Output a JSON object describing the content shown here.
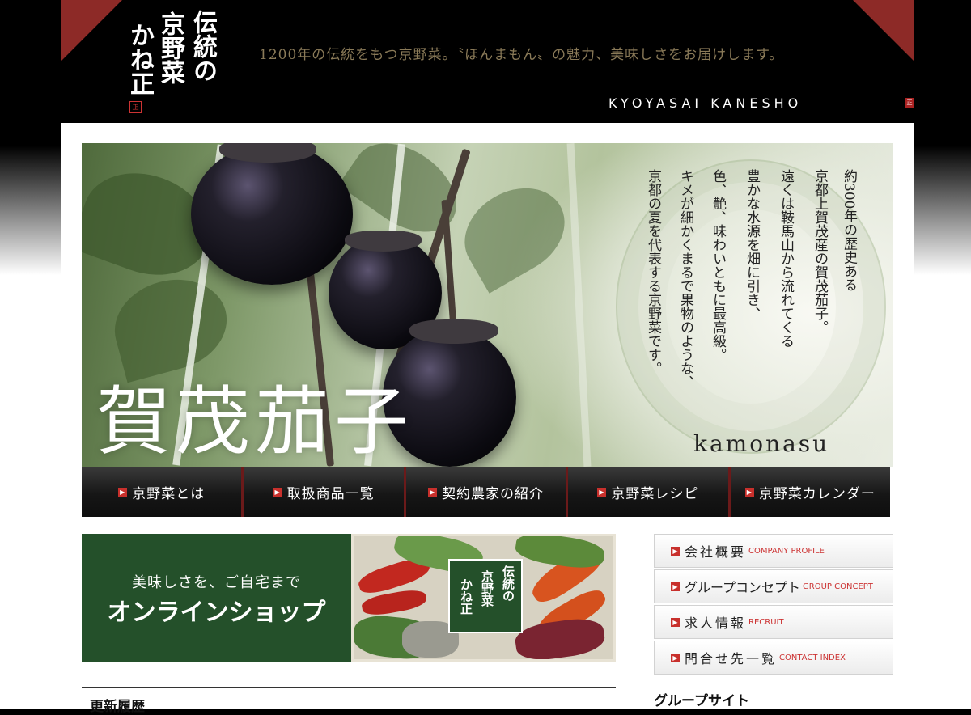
{
  "header": {
    "logo_lines": [
      "伝統の",
      "京野菜",
      "かね正"
    ],
    "tagline": "1200年の伝統をもつ京野菜。〝ほんまもん〟の魅力、美味しさをお届けします。",
    "brand_en": "KYOYASAI KANESHO",
    "seal": "正"
  },
  "hero": {
    "title": "賀茂茄子",
    "subtitle": "kamonasu",
    "description_columns": [
      "約300年の歴史ある",
      "京都上賀茂産の賀茂茄子。",
      "遠くは鞍馬山から流れてくる",
      "豊かな水源を畑に引き、",
      "色、艶、味わいともに最高級。",
      "キメが細かくまるで果物のような、",
      "京都の夏を代表する京野菜です。"
    ]
  },
  "main_nav": [
    {
      "label": "京野菜とは"
    },
    {
      "label": "取扱商品一覧"
    },
    {
      "label": "契約農家の紹介"
    },
    {
      "label": "京野菜レシピ"
    },
    {
      "label": "京野菜カレンダー"
    }
  ],
  "shop_banner": {
    "line1": "美味しさを、ご自宅まで",
    "line2": "オンラインショップ",
    "logo_lines": [
      "伝統の",
      "京野菜",
      "かね正"
    ]
  },
  "side_menu": [
    {
      "jp": "会社概要",
      "en": "COMPANY PROFILE"
    },
    {
      "jp": "グループコンセプト",
      "en": "GROUP CONCEPT"
    },
    {
      "jp": "求人情報",
      "en": "RECRUIT"
    },
    {
      "jp": "問合せ先一覧",
      "en": "CONTACT INDEX"
    }
  ],
  "news": {
    "heading": "更新履歴"
  },
  "group_sites": {
    "heading": "グループサイト"
  },
  "colors": {
    "accent_red": "#8d2a27",
    "shop_green": "#24502a",
    "header_bg": "#000000",
    "side_en_red": "#cc3333"
  }
}
